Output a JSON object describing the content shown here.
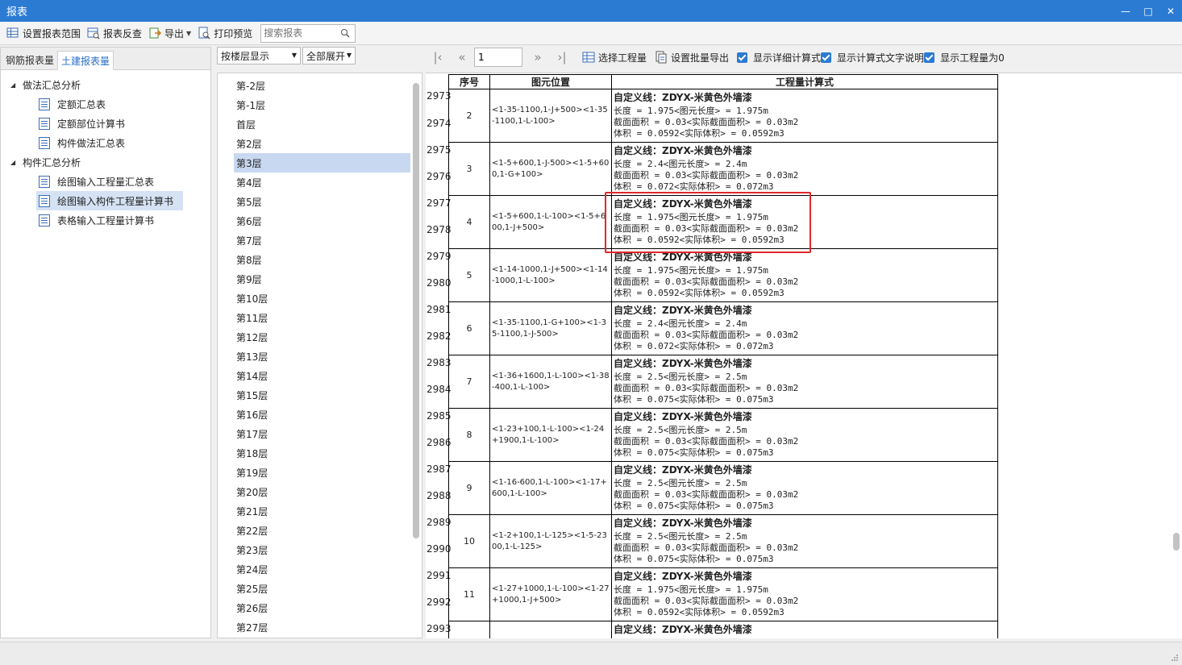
{
  "window": {
    "title": "报表"
  },
  "toolbar": {
    "set_range": "设置报表范围",
    "reverse_check": "报表反查",
    "export": "导出",
    "print_preview": "打印预览",
    "search_placeholder": "搜索报表"
  },
  "left": {
    "tabs": [
      "钢筋报表量",
      "土建报表量"
    ],
    "groups": [
      {
        "label": "做法汇总分析",
        "items": [
          "定额汇总表",
          "定额部位计算书",
          "构件做法汇总表"
        ]
      },
      {
        "label": "构件汇总分析",
        "items": [
          "绘图输入工程量汇总表",
          "绘图输入构件工程量计算书",
          "表格输入工程量计算书"
        ]
      }
    ]
  },
  "middle": {
    "mode": "按楼层显示",
    "expand": "全部展开",
    "floors": [
      "第-2层",
      "第-1层",
      "首层",
      "第2层",
      "第3层",
      "第4层",
      "第5层",
      "第6层",
      "第7层",
      "第8层",
      "第9层",
      "第10层",
      "第11层",
      "第12层",
      "第13层",
      "第14层",
      "第15层",
      "第16层",
      "第17层",
      "第18层",
      "第19层",
      "第20层",
      "第21层",
      "第22层",
      "第23层",
      "第24层",
      "第25层",
      "第26层",
      "第27层"
    ],
    "selected": "第3层"
  },
  "right_toolbar": {
    "page": "1",
    "select_project": "选择工程量",
    "batch_export": "设置批量导出",
    "chk_detail": "显示详细计算式",
    "chk_text": "显示计算式文字说明",
    "chk_zero": "显示工程量为0"
  },
  "report": {
    "headers": [
      "序号",
      "图元位置",
      "工程量计算式"
    ],
    "line_numbers": [
      "2973",
      "2974",
      "2975",
      "2976",
      "2977",
      "2978",
      "2979",
      "2980",
      "2981",
      "2982",
      "2983",
      "2984",
      "2985",
      "2986",
      "2987",
      "2988",
      "2989",
      "2990",
      "2991",
      "2992",
      "2993"
    ],
    "rows": [
      {
        "seq": "2",
        "pos": "<1-35-1100,1-J+500><1-35-1100,1-L-100>",
        "title": "自定义线：ZDYX-米黄色外墙漆",
        "lines": [
          "长度 = 1.975<图元长度> = 1.975m",
          "截面面积 = 0.03<实际截面面积> = 0.03m2",
          "体积 = 0.0592<实际体积> = 0.0592m3"
        ]
      },
      {
        "seq": "3",
        "pos": "<1-5+600,1-J-500><1-5+600,1-G+100>",
        "title": "自定义线：ZDYX-米黄色外墙漆",
        "lines": [
          "长度 = 2.4<图元长度> = 2.4m",
          "截面面积 = 0.03<实际截面面积> = 0.03m2",
          "体积 = 0.072<实际体积> = 0.072m3"
        ]
      },
      {
        "seq": "4",
        "pos": "<1-5+600,1-L-100><1-5+600,1-J+500>",
        "title": "自定义线：ZDYX-米黄色外墙漆",
        "lines": [
          "长度 = 1.975<图元长度> = 1.975m",
          "截面面积 = 0.03<实际截面面积> = 0.03m2",
          "体积 = 0.0592<实际体积> = 0.0592m3"
        ]
      },
      {
        "seq": "5",
        "pos": "<1-14-1000,1-J+500><1-14-1000,1-L-100>",
        "title": "自定义线：ZDYX-米黄色外墙漆",
        "lines": [
          "长度 = 1.975<图元长度> = 1.975m",
          "截面面积 = 0.03<实际截面面积> = 0.03m2",
          "体积 = 0.0592<实际体积> = 0.0592m3"
        ]
      },
      {
        "seq": "6",
        "pos": "<1-35-1100,1-G+100><1-35-1100,1-J-500>",
        "title": "自定义线：ZDYX-米黄色外墙漆",
        "lines": [
          "长度 = 2.4<图元长度> = 2.4m",
          "截面面积 = 0.03<实际截面面积> = 0.03m2",
          "体积 = 0.072<实际体积> = 0.072m3"
        ]
      },
      {
        "seq": "7",
        "pos": "<1-36+1600,1-L-100><1-38-400,1-L-100>",
        "title": "自定义线：ZDYX-米黄色外墙漆",
        "lines": [
          "长度 = 2.5<图元长度> = 2.5m",
          "截面面积 = 0.03<实际截面面积> = 0.03m2",
          "体积 = 0.075<实际体积> = 0.075m3"
        ]
      },
      {
        "seq": "8",
        "pos": "<1-23+100,1-L-100><1-24+1900,1-L-100>",
        "title": "自定义线：ZDYX-米黄色外墙漆",
        "lines": [
          "长度 = 2.5<图元长度> = 2.5m",
          "截面面积 = 0.03<实际截面面积> = 0.03m2",
          "体积 = 0.075<实际体积> = 0.075m3"
        ]
      },
      {
        "seq": "9",
        "pos": "<1-16-600,1-L-100><1-17+600,1-L-100>",
        "title": "自定义线：ZDYX-米黄色外墙漆",
        "lines": [
          "长度 = 2.5<图元长度> = 2.5m",
          "截面面积 = 0.03<实际截面面积> = 0.03m2",
          "体积 = 0.075<实际体积> = 0.075m3"
        ]
      },
      {
        "seq": "10",
        "pos": "<1-2+100,1-L-125><1-5-2300,1-L-125>",
        "title": "自定义线：ZDYX-米黄色外墙漆",
        "lines": [
          "长度 = 2.5<图元长度> = 2.5m",
          "截面面积 = 0.03<实际截面面积> = 0.03m2",
          "体积 = 0.075<实际体积> = 0.075m3"
        ]
      },
      {
        "seq": "11",
        "pos": "<1-27+1000,1-L-100><1-27+1000,1-J+500>",
        "title": "自定义线：ZDYX-米黄色外墙漆",
        "lines": [
          "长度 = 1.975<图元长度> = 1.975m",
          "截面面积 = 0.03<实际截面面积> = 0.03m2",
          "体积 = 0.0592<实际体积> = 0.0592m3"
        ]
      },
      {
        "seq": "",
        "pos": "",
        "title": "自定义线：ZDYX-米黄色外墙漆",
        "lines": [
          "",
          "",
          ""
        ]
      }
    ]
  },
  "colors": {
    "accent": "#2b7bd3",
    "highlight": "#e0272b",
    "selection": "#c8d8f0"
  }
}
